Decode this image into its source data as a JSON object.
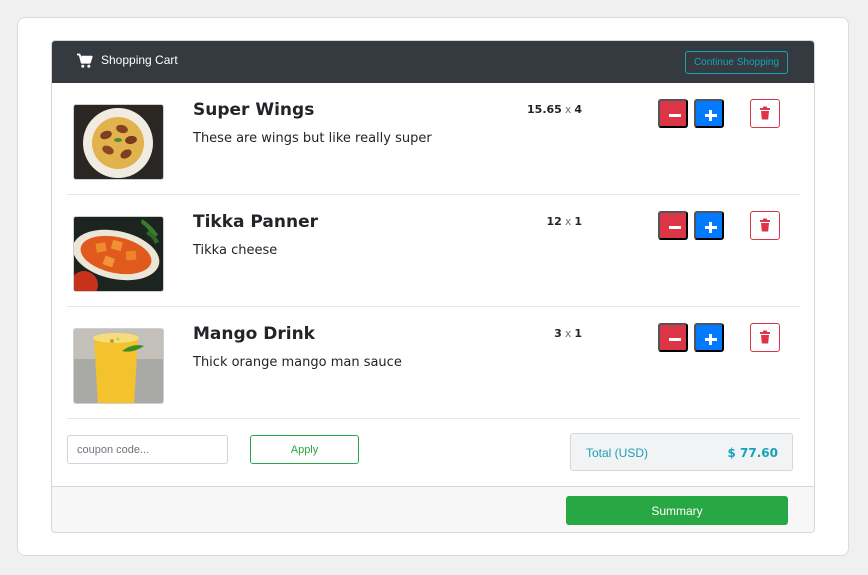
{
  "header": {
    "title": "Shopping Cart",
    "cart_icon": "shopping-cart-icon",
    "continue_label": "Continue Shopping"
  },
  "items": [
    {
      "name": "Super Wings",
      "description": "These are wings but like really super",
      "price": "15.65",
      "times": "x",
      "quantity": "4",
      "image": "dish-with-fried-balls-in-curry"
    },
    {
      "name": "Tikka Panner",
      "description": "Tikka cheese",
      "price": "12",
      "times": "x",
      "quantity": "1",
      "image": "paneer-tikka-in-oval-dish"
    },
    {
      "name": "Mango Drink",
      "description": "Thick orange mango man sauce",
      "price": "3",
      "times": "x",
      "quantity": "1",
      "image": "mango-lassi-glass"
    }
  ],
  "item_icons": {
    "decrease": "minus-icon",
    "increase": "plus-icon",
    "remove": "trash-icon"
  },
  "coupon": {
    "placeholder": "coupon code...",
    "value": "",
    "apply_label": "Apply"
  },
  "total": {
    "label": "Total (USD)",
    "value": "$ 77.60"
  },
  "footer": {
    "summary_label": "Summary"
  },
  "colors": {
    "header_bg": "#343a40",
    "info": "#17a2b8",
    "danger": "#dc3545",
    "primary": "#007bff",
    "success": "#28a745"
  }
}
